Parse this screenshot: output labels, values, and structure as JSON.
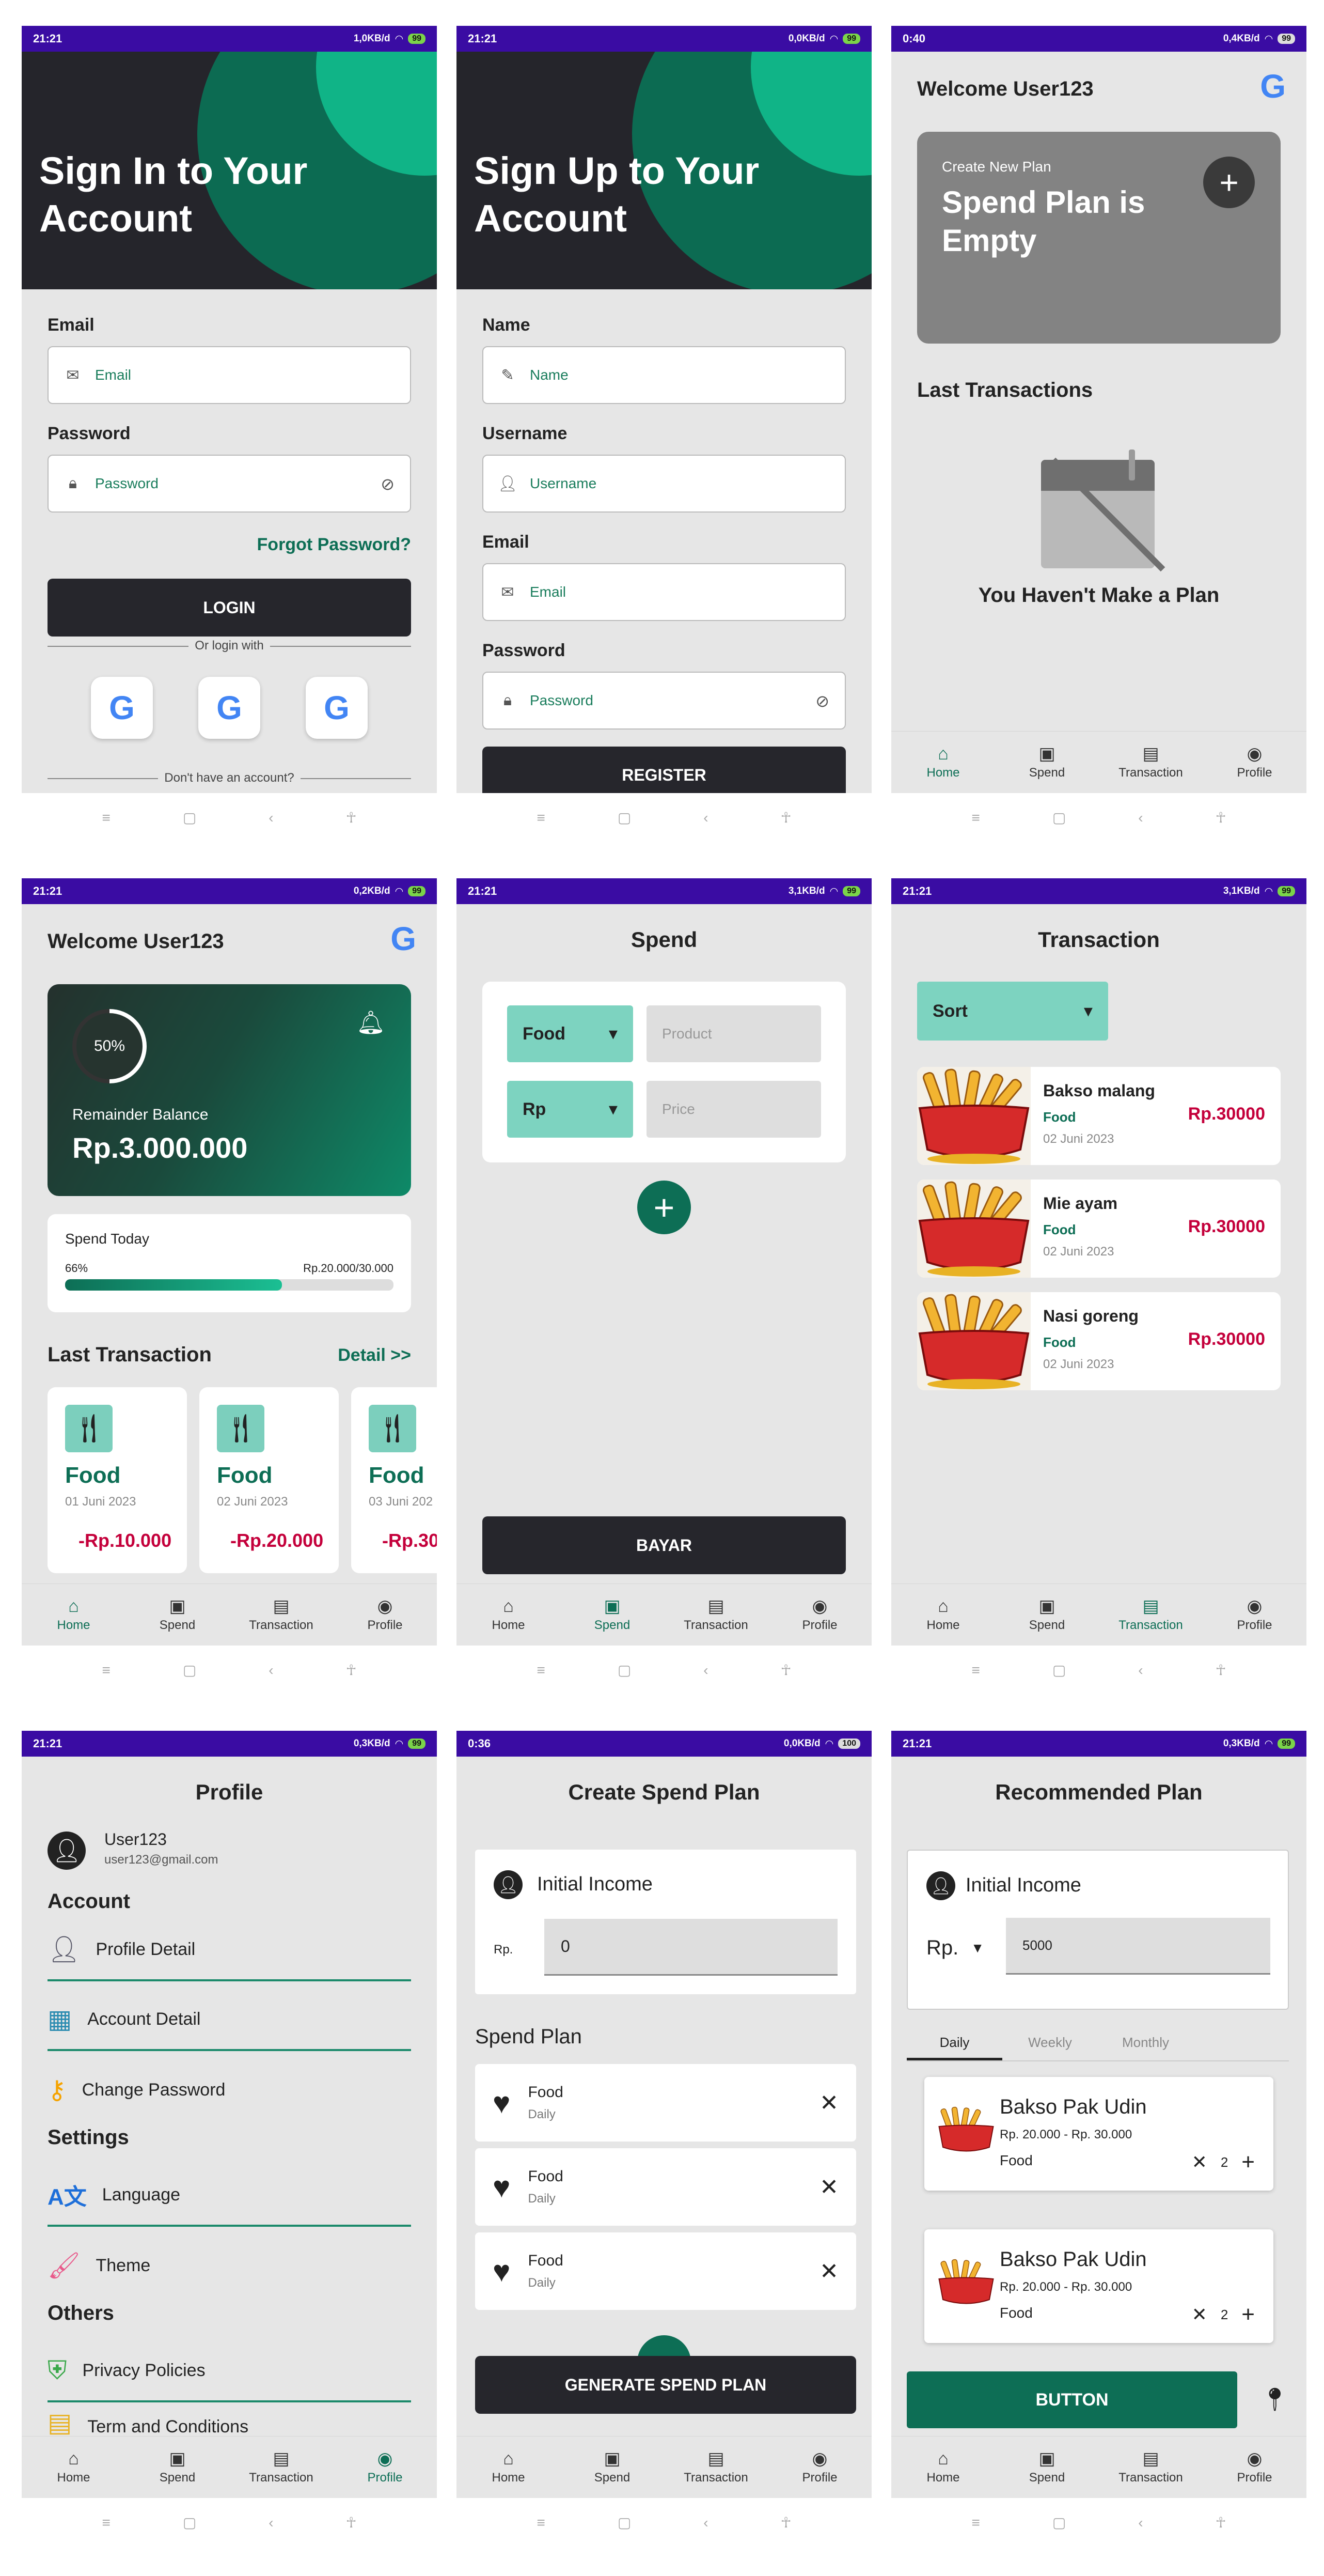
{
  "status": {
    "time_a": "21:21",
    "time_b": "0:40",
    "time_c": "0:36",
    "net_a": "1,0KB/d",
    "net_b": "0,0KB/d",
    "net_c": "0,4KB/d",
    "net_d": "0,2KB/d",
    "net_e": "3,1KB/d",
    "net_f": "0,3KB/d",
    "bat": "99",
    "bat2": "100"
  },
  "signin": {
    "title": "Sign In to Your Account",
    "email_label": "Email",
    "email_ph": "Email",
    "password_label": "Password",
    "password_ph": "Password",
    "forgot": "Forgot Password?",
    "login": "LOGIN",
    "or": "Or login with",
    "no_account": "Don't have an account?"
  },
  "signup": {
    "title": "Sign Up to Your Account",
    "name_label": "Name",
    "name_ph": "Name",
    "username_label": "Username",
    "username_ph": "Username",
    "email_label": "Email",
    "email_ph": "Email",
    "password_label": "Password",
    "password_ph": "Password",
    "register": "REGISTER"
  },
  "empty": {
    "welcome": "Welcome User123",
    "create_small": "Create New Plan",
    "create_big": "Spend Plan is Empty",
    "last": "Last Transactions",
    "none": "You Haven't Make a Plan"
  },
  "nav": {
    "home": "Home",
    "spend": "Spend",
    "transaction": "Transaction",
    "profile": "Profile"
  },
  "home": {
    "welcome": "Welcome User123",
    "percent": "50%",
    "remainder_label": "Remainder Balance",
    "remainder": "Rp.3.000.000",
    "spend_today": "Spend Today",
    "pct": "66%",
    "range": "Rp.20.000/30.000",
    "last": "Last Transaction",
    "detail": "Detail >>",
    "cards": [
      {
        "cat": "Food",
        "date": "01 Juni 2023",
        "amt": "-Rp.10.000"
      },
      {
        "cat": "Food",
        "date": "02 Juni 2023",
        "amt": "-Rp.20.000"
      },
      {
        "cat": "Food",
        "date": "03 Juni 202",
        "amt": "-Rp.30"
      }
    ]
  },
  "spend": {
    "title": "Spend",
    "food": "Food",
    "product_ph": "Product",
    "rp": "Rp",
    "price_ph": "Price",
    "bayar": "BAYAR"
  },
  "transaction": {
    "title": "Transaction",
    "sort": "Sort",
    "items": [
      {
        "name": "Bakso malang",
        "cat": "Food",
        "date": "02 Juni 2023",
        "amt": "Rp.30000"
      },
      {
        "name": "Mie ayam",
        "cat": "Food",
        "date": "02 Juni 2023",
        "amt": "Rp.30000"
      },
      {
        "name": "Nasi goreng",
        "cat": "Food",
        "date": "02 Juni 2023",
        "amt": "Rp.30000"
      }
    ]
  },
  "profile": {
    "title": "Profile",
    "user": "User123",
    "email": "user123@gmail.com",
    "account": "Account",
    "profile_detail": "Profile Detail",
    "account_detail": "Account Detail",
    "change_password": "Change Password",
    "settings": "Settings",
    "language": "Language",
    "theme": "Theme",
    "others": "Others",
    "privacy": "Privacy Policies",
    "terms": "Term and Conditions"
  },
  "create": {
    "title": "Create Spend Plan",
    "income": "Initial Income",
    "rp": "Rp.",
    "value": "0",
    "spend_plan": "Spend Plan",
    "items": [
      {
        "name": "Food",
        "freq": "Daily"
      },
      {
        "name": "Food",
        "freq": "Daily"
      },
      {
        "name": "Food",
        "freq": "Daily"
      }
    ],
    "generate": "GENERATE SPEND PLAN"
  },
  "recommend": {
    "title": "Recommended Plan",
    "income": "Initial Income",
    "rp": "Rp.",
    "value": "5000",
    "tabs": [
      "Daily",
      "Weekly",
      "Monthly"
    ],
    "items": [
      {
        "name": "Bakso Pak Udin",
        "range": "Rp. 20.000 - Rp. 30.000",
        "cat": "Food",
        "qty": "2"
      },
      {
        "name": "Bakso Pak Udin",
        "range": "Rp. 20.000 - Rp. 30.000",
        "cat": "Food",
        "qty": "2"
      }
    ],
    "button": "BUTTON"
  },
  "colors": {
    "primary": "#0d6e55",
    "dark": "#26262c",
    "status": "#3a0ca3",
    "red": "#c4003b"
  }
}
